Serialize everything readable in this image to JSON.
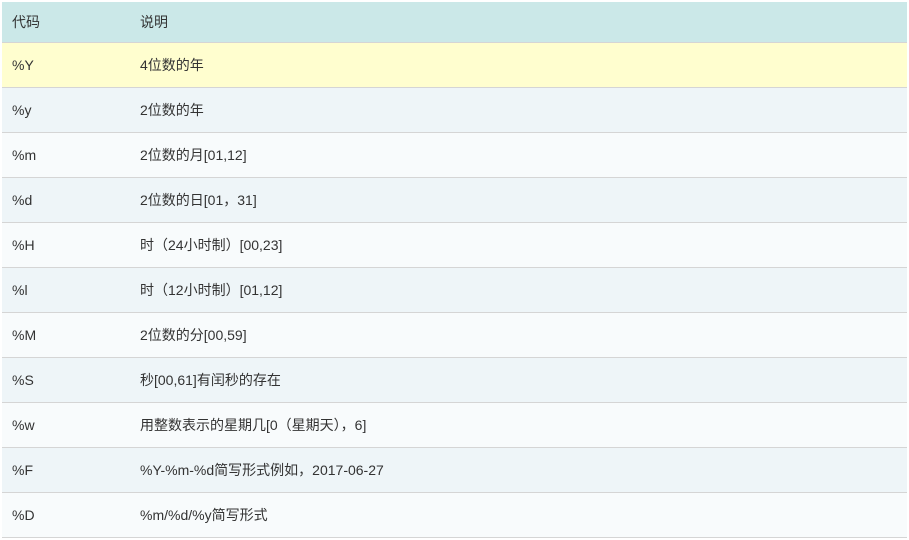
{
  "table": {
    "headers": {
      "code": "代码",
      "description": "说明"
    },
    "rows": [
      {
        "code": "%Y",
        "description": "4位数的年"
      },
      {
        "code": "%y",
        "description": "2位数的年"
      },
      {
        "code": "%m",
        "description": "2位数的月[01,12]"
      },
      {
        "code": "%d",
        "description": "2位数的日[01，31]"
      },
      {
        "code": "%H",
        "description": "时（24小时制）[00,23]"
      },
      {
        "code": "%l",
        "description": "时（12小时制）[01,12]"
      },
      {
        "code": "%M",
        "description": "2位数的分[00,59]"
      },
      {
        "code": "%S",
        "description": "秒[00,61]有闰秒的存在"
      },
      {
        "code": "%w",
        "description": "用整数表示的星期几[0（星期天），6]"
      },
      {
        "code": "%F",
        "description": "%Y-%m-%d简写形式例如，2017-06-27"
      },
      {
        "code": "%D",
        "description": "%m/%d/%y简写形式"
      }
    ]
  }
}
